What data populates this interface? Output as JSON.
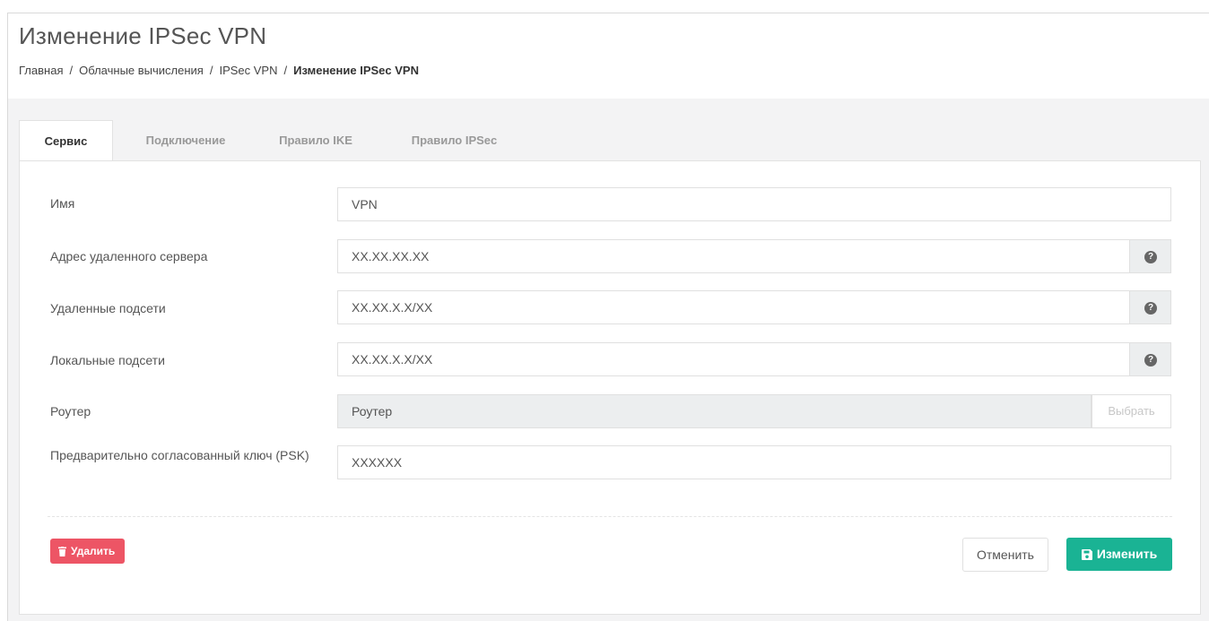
{
  "page": {
    "title": "Изменение IPSec VPN",
    "breadcrumb": [
      "Главная",
      "Облачные вычисления",
      "IPSec VPN",
      "Изменение IPSec VPN"
    ]
  },
  "tabs": [
    "Сервис",
    "Подключение",
    "Правило IKE",
    "Правило IPSec"
  ],
  "active_tab": "Сервис",
  "form": {
    "name": {
      "label": "Имя",
      "value": "VPN"
    },
    "remote_address": {
      "label": "Адрес удаленного сервера",
      "value": "XX.XX.XX.XX",
      "help_icon": "question-circle-icon"
    },
    "remote_subnets": {
      "label": "Удаленные подсети",
      "value": "XX.XX.X.X/XX",
      "help_icon": "question-circle-icon"
    },
    "local_subnets": {
      "label": "Локальные подсети",
      "value": "XX.XX.X.X/XX",
      "help_icon": "question-circle-icon"
    },
    "router": {
      "label": "Роутер",
      "value": "Роутер",
      "button_label": "Выбрать"
    },
    "psk": {
      "label": "Предварительно согласованный ключ (PSK)",
      "value": "XXXXXX"
    }
  },
  "actions": {
    "delete_label": "Удалить",
    "delete_icon": "trash-icon",
    "cancel_label": "Отменить",
    "save_label": "Изменить",
    "save_icon": "floppy-disk-icon"
  },
  "colors": {
    "delete": "#ed5565",
    "save": "#1ab394",
    "page_background": "#f3f3f4"
  }
}
